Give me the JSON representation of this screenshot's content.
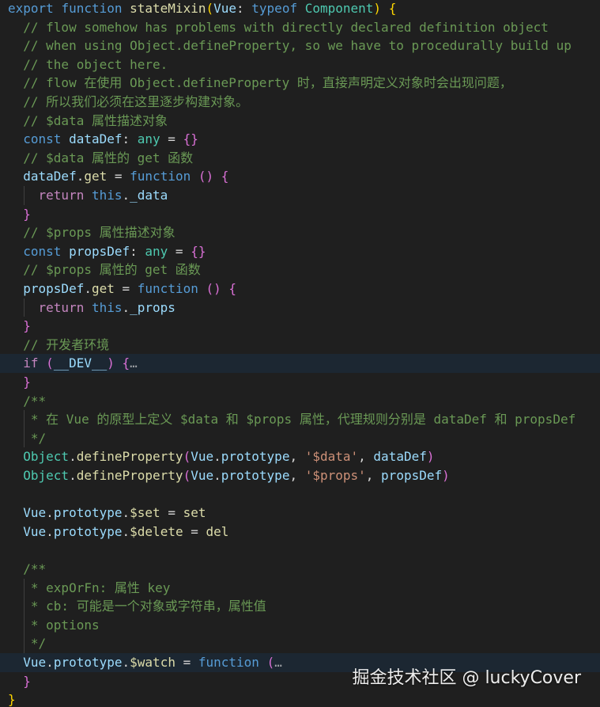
{
  "code_lines": [
    [
      {
        "c": "kw",
        "t": "export "
      },
      {
        "c": "kw",
        "t": "function "
      },
      {
        "c": "fn",
        "t": "stateMixin"
      },
      {
        "c": "br1",
        "t": "("
      },
      {
        "c": "var",
        "t": "Vue"
      },
      {
        "c": "plain",
        "t": ": "
      },
      {
        "c": "kw",
        "t": "typeof "
      },
      {
        "c": "type",
        "t": "Component"
      },
      {
        "c": "br1",
        "t": ")"
      },
      {
        "c": "plain",
        "t": " "
      },
      {
        "c": "br1",
        "t": "{"
      }
    ],
    [
      {
        "c": "cmt",
        "t": "  // flow somehow has problems with directly declared definition object"
      }
    ],
    [
      {
        "c": "cmt",
        "t": "  // when using Object.defineProperty, so we have to procedurally build up"
      }
    ],
    [
      {
        "c": "cmt",
        "t": "  // the object here."
      }
    ],
    [
      {
        "c": "cmt",
        "t": "  // flow 在使用 Object.defineProperty 时，直接声明定义对象时会出现问题，"
      }
    ],
    [
      {
        "c": "cmt",
        "t": "  // 所以我们必须在这里逐步构建对象。"
      }
    ],
    [
      {
        "c": "cmt",
        "t": "  // $data 属性描述对象"
      }
    ],
    [
      {
        "c": "kw",
        "t": "  const "
      },
      {
        "c": "var",
        "t": "dataDef"
      },
      {
        "c": "plain",
        "t": ": "
      },
      {
        "c": "type",
        "t": "any"
      },
      {
        "c": "plain",
        "t": " = "
      },
      {
        "c": "br2",
        "t": "{}"
      }
    ],
    [
      {
        "c": "cmt",
        "t": "  // $data 属性的 get 函数"
      }
    ],
    [
      {
        "c": "var",
        "t": "  dataDef"
      },
      {
        "c": "plain",
        "t": "."
      },
      {
        "c": "fn",
        "t": "get"
      },
      {
        "c": "plain",
        "t": " = "
      },
      {
        "c": "kw",
        "t": "function "
      },
      {
        "c": "br2",
        "t": "()"
      },
      {
        "c": "plain",
        "t": " "
      },
      {
        "c": "br2",
        "t": "{"
      }
    ],
    [
      {
        "c": "kw2",
        "t": "    return "
      },
      {
        "c": "kw",
        "t": "this"
      },
      {
        "c": "plain",
        "t": "."
      },
      {
        "c": "var",
        "t": "_data"
      }
    ],
    [
      {
        "c": "br2",
        "t": "  }"
      }
    ],
    [
      {
        "c": "cmt",
        "t": "  // $props 属性描述对象"
      }
    ],
    [
      {
        "c": "kw",
        "t": "  const "
      },
      {
        "c": "var",
        "t": "propsDef"
      },
      {
        "c": "plain",
        "t": ": "
      },
      {
        "c": "type",
        "t": "any"
      },
      {
        "c": "plain",
        "t": " = "
      },
      {
        "c": "br2",
        "t": "{}"
      }
    ],
    [
      {
        "c": "cmt",
        "t": "  // $props 属性的 get 函数"
      }
    ],
    [
      {
        "c": "var",
        "t": "  propsDef"
      },
      {
        "c": "plain",
        "t": "."
      },
      {
        "c": "fn",
        "t": "get"
      },
      {
        "c": "plain",
        "t": " = "
      },
      {
        "c": "kw",
        "t": "function "
      },
      {
        "c": "br2",
        "t": "()"
      },
      {
        "c": "plain",
        "t": " "
      },
      {
        "c": "br2",
        "t": "{"
      }
    ],
    [
      {
        "c": "kw2",
        "t": "    return "
      },
      {
        "c": "kw",
        "t": "this"
      },
      {
        "c": "plain",
        "t": "."
      },
      {
        "c": "var",
        "t": "_props"
      }
    ],
    [
      {
        "c": "br2",
        "t": "  }"
      }
    ],
    [
      {
        "c": "cmt",
        "t": "  // 开发者环境"
      }
    ],
    [
      {
        "c": "kw2",
        "t": "  if "
      },
      {
        "c": "br2",
        "t": "("
      },
      {
        "c": "var",
        "t": "__DEV__"
      },
      {
        "c": "br2",
        "t": ")"
      },
      {
        "c": "plain",
        "t": " "
      },
      {
        "c": "br2",
        "t": "{"
      },
      {
        "c": "fold",
        "t": "…"
      }
    ],
    [
      {
        "c": "br2",
        "t": "  }"
      }
    ],
    [
      {
        "c": "cmt",
        "t": "  /**"
      }
    ],
    [
      {
        "c": "cmt",
        "t": "   * 在 Vue 的原型上定义 $data 和 $props 属性，代理规则分别是 dataDef 和 propsDef"
      }
    ],
    [
      {
        "c": "cmt",
        "t": "   */"
      }
    ],
    [
      {
        "c": "type",
        "t": "  Object"
      },
      {
        "c": "plain",
        "t": "."
      },
      {
        "c": "fn",
        "t": "defineProperty"
      },
      {
        "c": "br2",
        "t": "("
      },
      {
        "c": "var",
        "t": "Vue"
      },
      {
        "c": "plain",
        "t": "."
      },
      {
        "c": "var",
        "t": "prototype"
      },
      {
        "c": "plain",
        "t": ", "
      },
      {
        "c": "str",
        "t": "'$data'"
      },
      {
        "c": "plain",
        "t": ", "
      },
      {
        "c": "var",
        "t": "dataDef"
      },
      {
        "c": "br2",
        "t": ")"
      }
    ],
    [
      {
        "c": "type",
        "t": "  Object"
      },
      {
        "c": "plain",
        "t": "."
      },
      {
        "c": "fn",
        "t": "defineProperty"
      },
      {
        "c": "br2",
        "t": "("
      },
      {
        "c": "var",
        "t": "Vue"
      },
      {
        "c": "plain",
        "t": "."
      },
      {
        "c": "var",
        "t": "prototype"
      },
      {
        "c": "plain",
        "t": ", "
      },
      {
        "c": "str",
        "t": "'$props'"
      },
      {
        "c": "plain",
        "t": ", "
      },
      {
        "c": "var",
        "t": "propsDef"
      },
      {
        "c": "br2",
        "t": ")"
      }
    ],
    [],
    [
      {
        "c": "var",
        "t": "  Vue"
      },
      {
        "c": "plain",
        "t": "."
      },
      {
        "c": "var",
        "t": "prototype"
      },
      {
        "c": "plain",
        "t": "."
      },
      {
        "c": "fn",
        "t": "$set"
      },
      {
        "c": "plain",
        "t": " = "
      },
      {
        "c": "fn",
        "t": "set"
      }
    ],
    [
      {
        "c": "var",
        "t": "  Vue"
      },
      {
        "c": "plain",
        "t": "."
      },
      {
        "c": "var",
        "t": "prototype"
      },
      {
        "c": "plain",
        "t": "."
      },
      {
        "c": "fn",
        "t": "$delete"
      },
      {
        "c": "plain",
        "t": " = "
      },
      {
        "c": "fn",
        "t": "del"
      }
    ],
    [],
    [
      {
        "c": "cmt",
        "t": "  /**"
      }
    ],
    [
      {
        "c": "cmt",
        "t": "   * expOrFn: 属性 key"
      }
    ],
    [
      {
        "c": "cmt",
        "t": "   * cb: 可能是一个对象或字符串，属性值"
      }
    ],
    [
      {
        "c": "cmt",
        "t": "   * options"
      }
    ],
    [
      {
        "c": "cmt",
        "t": "   */"
      }
    ],
    [
      {
        "c": "var",
        "t": "  Vue"
      },
      {
        "c": "plain",
        "t": "."
      },
      {
        "c": "var",
        "t": "prototype"
      },
      {
        "c": "plain",
        "t": "."
      },
      {
        "c": "fn",
        "t": "$watch"
      },
      {
        "c": "plain",
        "t": " = "
      },
      {
        "c": "kw",
        "t": "function "
      },
      {
        "c": "br2",
        "t": "("
      },
      {
        "c": "fold",
        "t": "…"
      }
    ],
    [
      {
        "c": "br2",
        "t": "  }"
      }
    ],
    [
      {
        "c": "br1",
        "t": "}"
      }
    ]
  ],
  "highlighted_lines": [
    19,
    35
  ],
  "watermark": "掘金技术社区 @ luckyCover"
}
